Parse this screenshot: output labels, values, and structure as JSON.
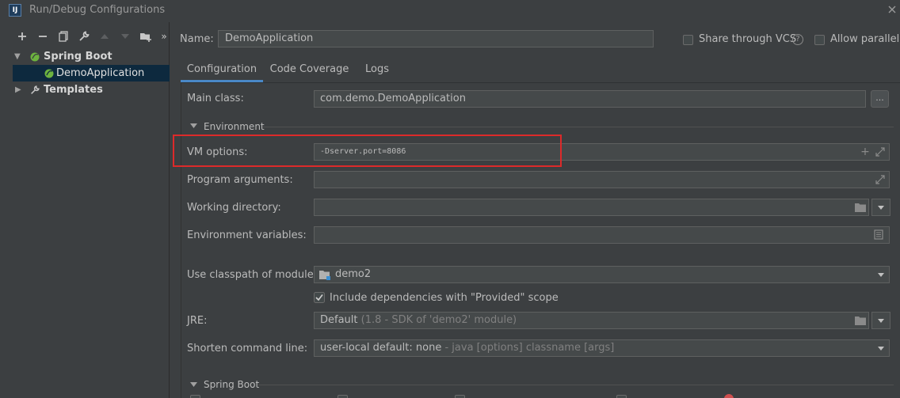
{
  "window": {
    "title": "Run/Debug Configurations",
    "app_icon_text": "IJ"
  },
  "toolbar": {
    "icons": [
      "plus-icon",
      "minus-icon",
      "copy-icon",
      "wrench-icon",
      "arrow-up-icon",
      "arrow-down-icon",
      "folder-add-icon",
      "more-icon"
    ]
  },
  "tree": {
    "groups": [
      {
        "label": "Spring Boot",
        "expanded": true,
        "children": [
          {
            "label": "DemoApplication",
            "selected": true
          }
        ]
      },
      {
        "label": "Templates",
        "expanded": false
      }
    ]
  },
  "name": {
    "label": "Name:",
    "value": "DemoApplication"
  },
  "options": {
    "share_vcs": "Share through VCS",
    "allow_parallel": "Allow parallel r"
  },
  "tabs": [
    {
      "label": "Configuration",
      "active": true
    },
    {
      "label": "Code Coverage",
      "active": false
    },
    {
      "label": "Logs",
      "active": false
    }
  ],
  "form": {
    "main_class": {
      "label": "Main class:",
      "value": "com.demo.DemoApplication",
      "browse": "..."
    },
    "environment_section": "Environment",
    "vm_options": {
      "label": "VM options:",
      "value": "-Dserver.port=8086"
    },
    "program_arguments": {
      "label": "Program arguments:",
      "value": ""
    },
    "working_directory": {
      "label": "Working directory:",
      "value": ""
    },
    "environment_variables": {
      "label": "Environment variables:",
      "value": ""
    },
    "classpath_module": {
      "label": "Use classpath of module:",
      "value": "demo2"
    },
    "include_provided": {
      "label": "Include dependencies with \"Provided\" scope",
      "checked": true
    },
    "jre": {
      "label": "JRE:",
      "value": "Default",
      "hint": "(1.8 - SDK of 'demo2' module)"
    },
    "shorten_command_line": {
      "label": "Shorten command line:",
      "value": "user-local default: none",
      "hint": "- java [options] classname [args]"
    },
    "spring_boot_section": "Spring Boot"
  },
  "colors": {
    "accent": "#4a88c7",
    "highlight_box": "#dd2a2a",
    "spring_green": "#6db33f",
    "selection": "#0d293e"
  }
}
